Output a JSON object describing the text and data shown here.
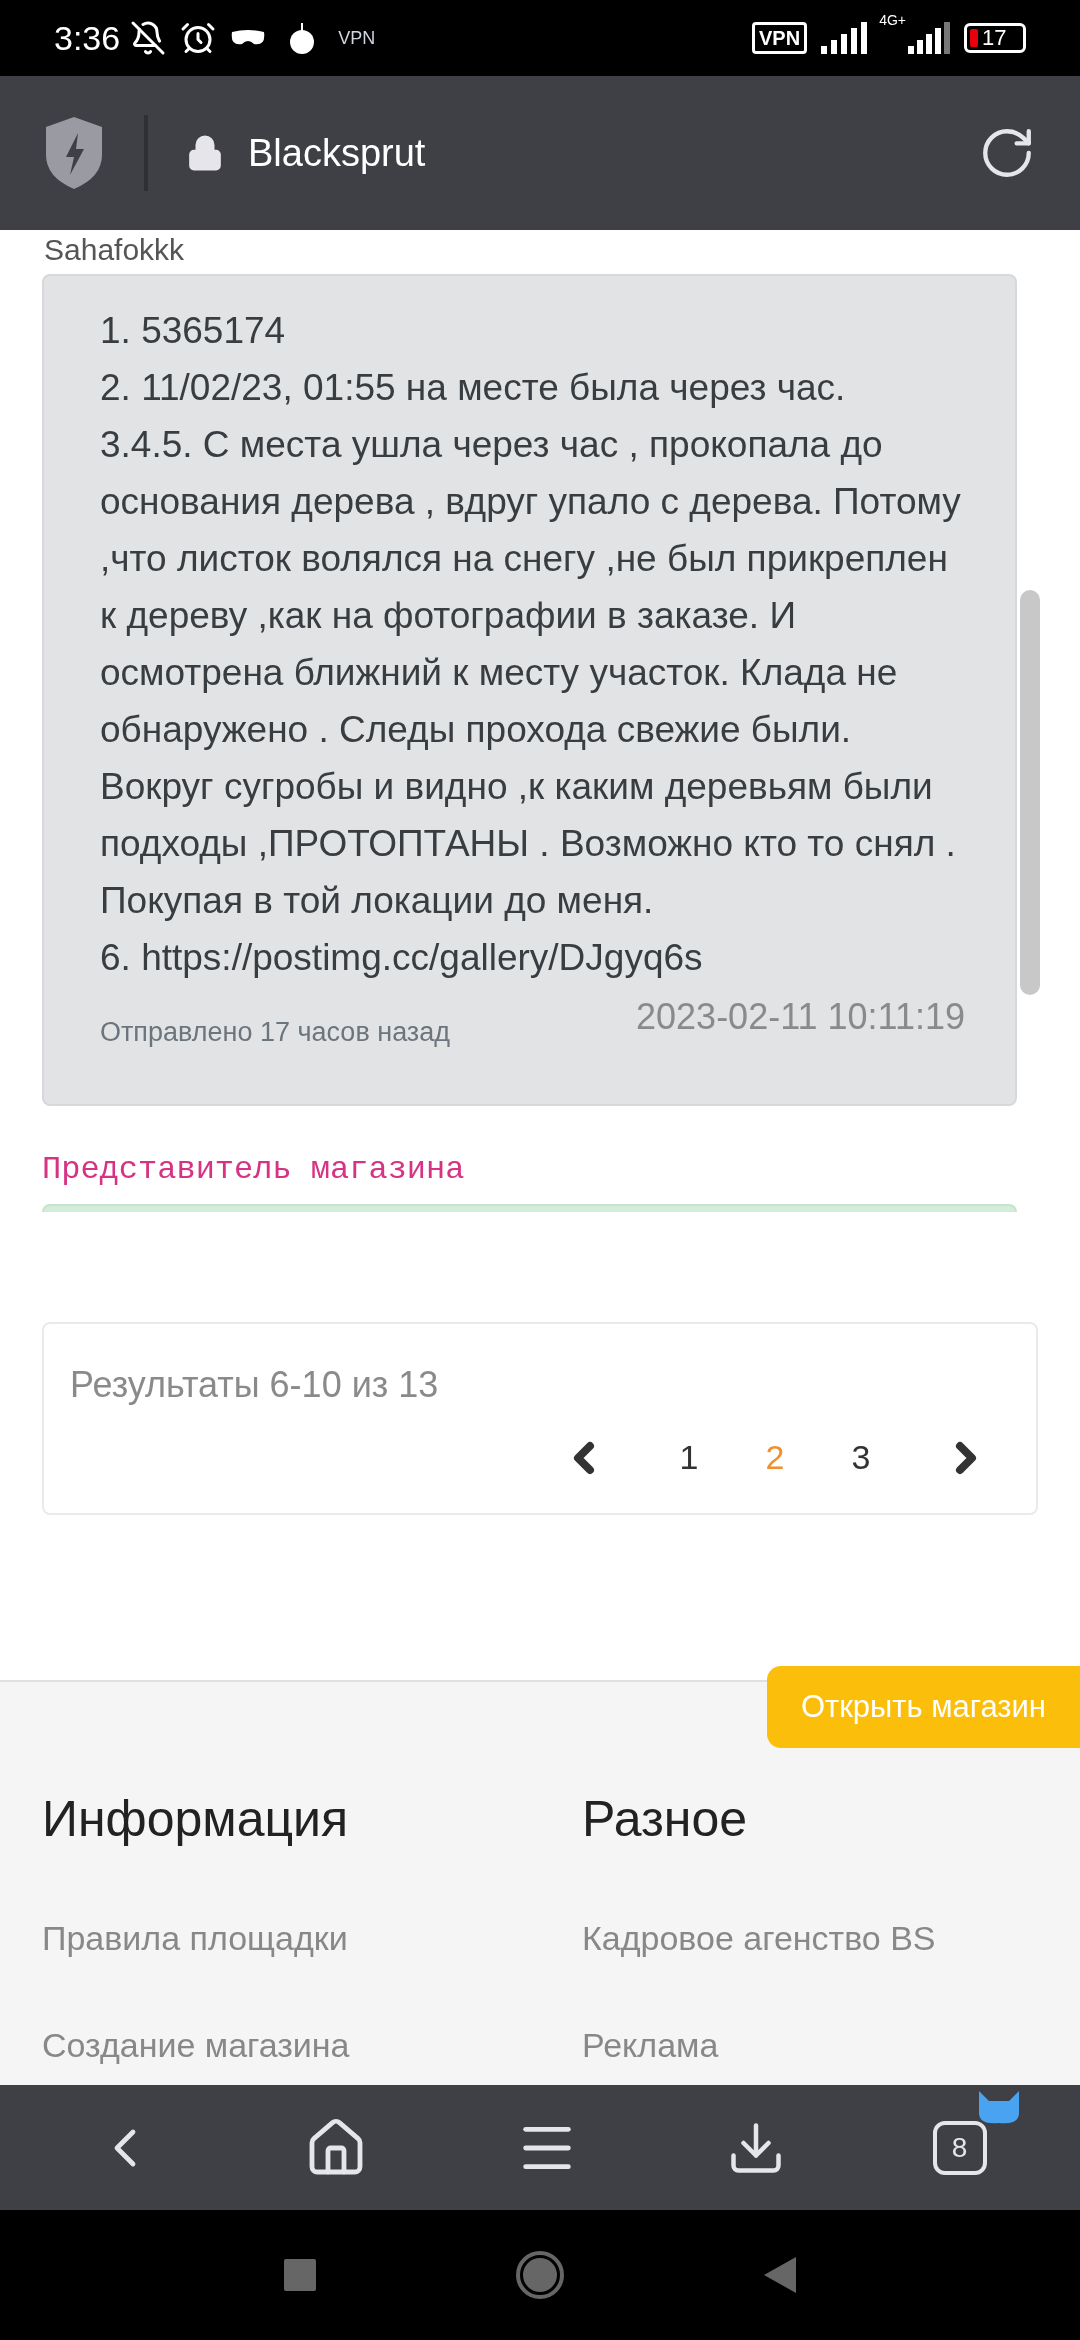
{
  "status_bar": {
    "time": "3:36",
    "vpn_label": "VPN",
    "vpn_badge": "VPN",
    "network": "4G+",
    "battery": "17"
  },
  "browser": {
    "title": "Blacksprut"
  },
  "message": {
    "author": "Sahafokkk",
    "lines": [
      "1. 5365174",
      "2. 11/02/23, 01:55 на месте была через час.",
      "3.4.5. С места ушла через час , прокопала до основания дерева , вдруг упало с дерева. Потому ,что листок волялся на снегу ,не был прикреплен к дереву ,как на фотографии в заказе. И осмотрена ближний к месту участок. Клада не обнаружено . Следы прохода свежие были. Вокруг сугробы и видно ,к каким деревьям были подходы ,ПРОТОПТАНЫ . Возможно кто то снял . Покупая в той локации до меня.",
      "6. https://postimg.cc/gallery/DJgyq6s"
    ],
    "timestamp": "2023-02-11 10:11:19",
    "sent": "Отправлено 17 часов назад"
  },
  "reply_author": "Представитель магазина",
  "pagination": {
    "summary": "Результаты 6-10 из 13",
    "pages": [
      {
        "label": "1",
        "selected": false
      },
      {
        "label": "2",
        "selected": true
      },
      {
        "label": "3",
        "selected": false
      }
    ]
  },
  "open_shop_button": "Открыть магазин",
  "footer": {
    "columns": [
      {
        "title": "Информация",
        "links": [
          "Правила площадки",
          "Создание магазина"
        ]
      },
      {
        "title": "Разное",
        "links": [
          "Кадровое агенство BS",
          "Реклама"
        ]
      }
    ]
  },
  "bottom_nav": {
    "tabs_count": "8"
  }
}
